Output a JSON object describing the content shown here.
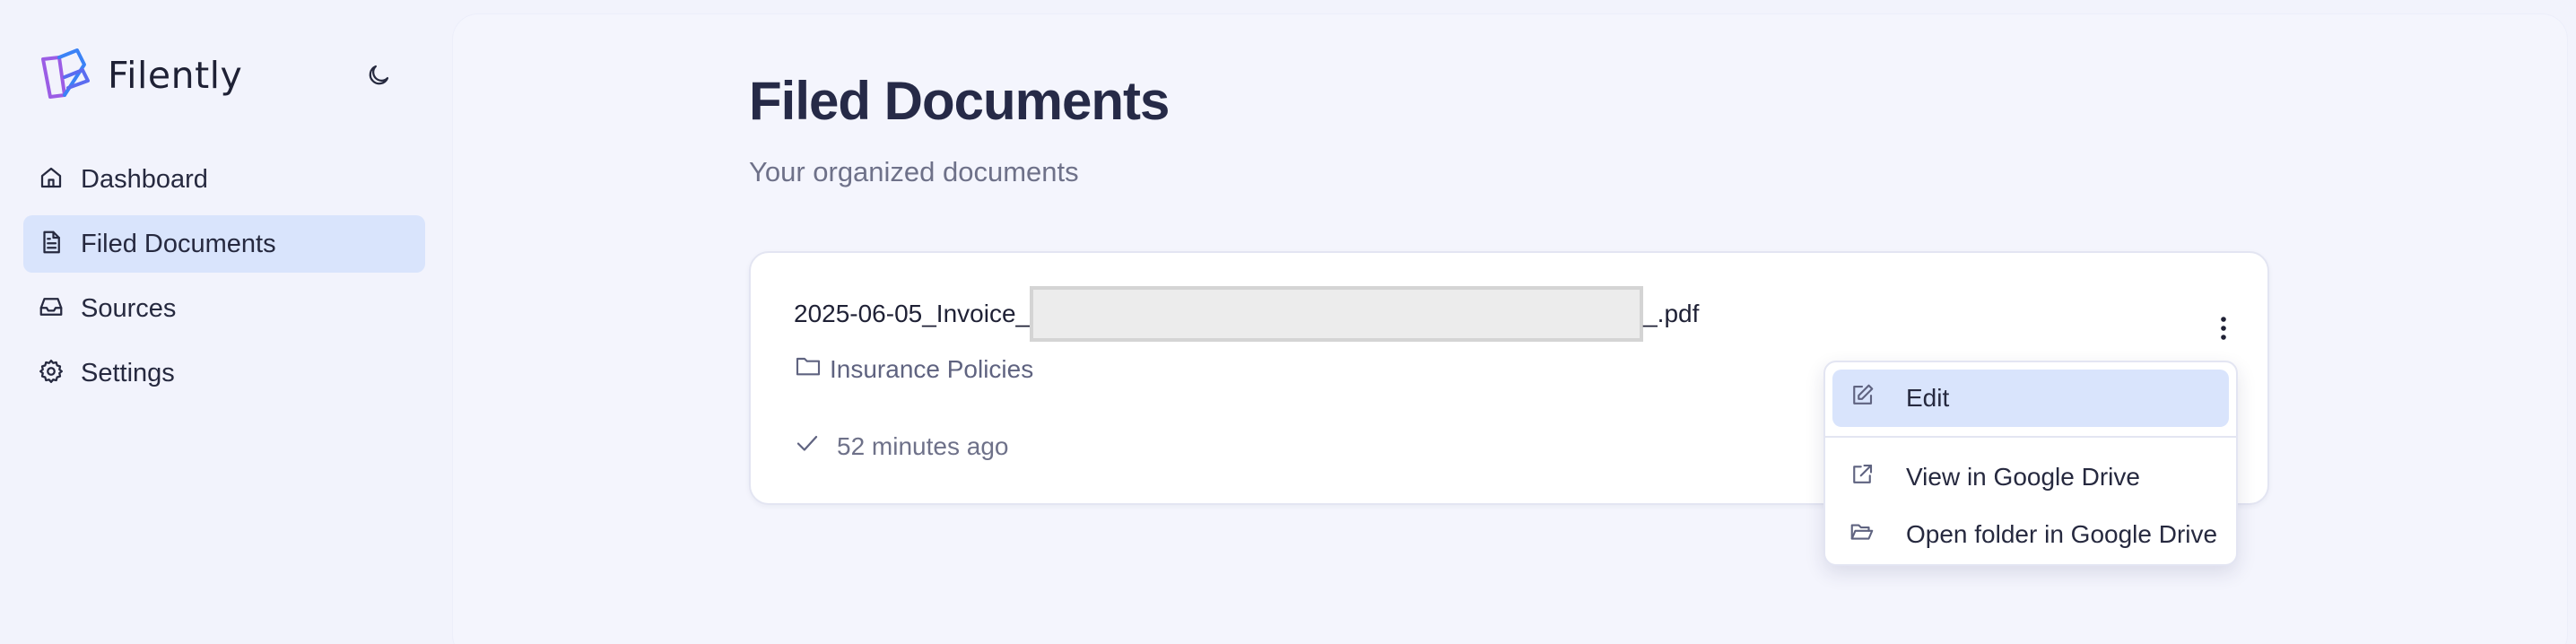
{
  "app": {
    "name": "Filently"
  },
  "colors": {
    "accent": "#d9e4fc",
    "logo_blue": "#3b82f6",
    "logo_purple": "#9b5de5"
  },
  "sidebar": {
    "items": [
      {
        "label": "Dashboard",
        "icon": "home-icon",
        "active": false
      },
      {
        "label": "Filed Documents",
        "icon": "document-icon",
        "active": true
      },
      {
        "label": "Sources",
        "icon": "inbox-icon",
        "active": false
      },
      {
        "label": "Settings",
        "icon": "gear-icon",
        "active": false
      }
    ],
    "theme_toggle_icon": "moon-icon"
  },
  "main": {
    "title": "Filed Documents",
    "subtitle": "Your organized documents",
    "document": {
      "name_prefix": "2025-06-05_Invoice_",
      "name_suffix": "_.pdf",
      "folder": "Insurance Policies",
      "time": "52 minutes ago"
    },
    "menu": {
      "items": [
        {
          "label": "Edit",
          "icon": "edit-icon"
        },
        {
          "label": "View in Google Drive",
          "icon": "external-link-icon"
        },
        {
          "label": "Open folder in Google Drive",
          "icon": "folder-open-icon"
        }
      ]
    }
  }
}
